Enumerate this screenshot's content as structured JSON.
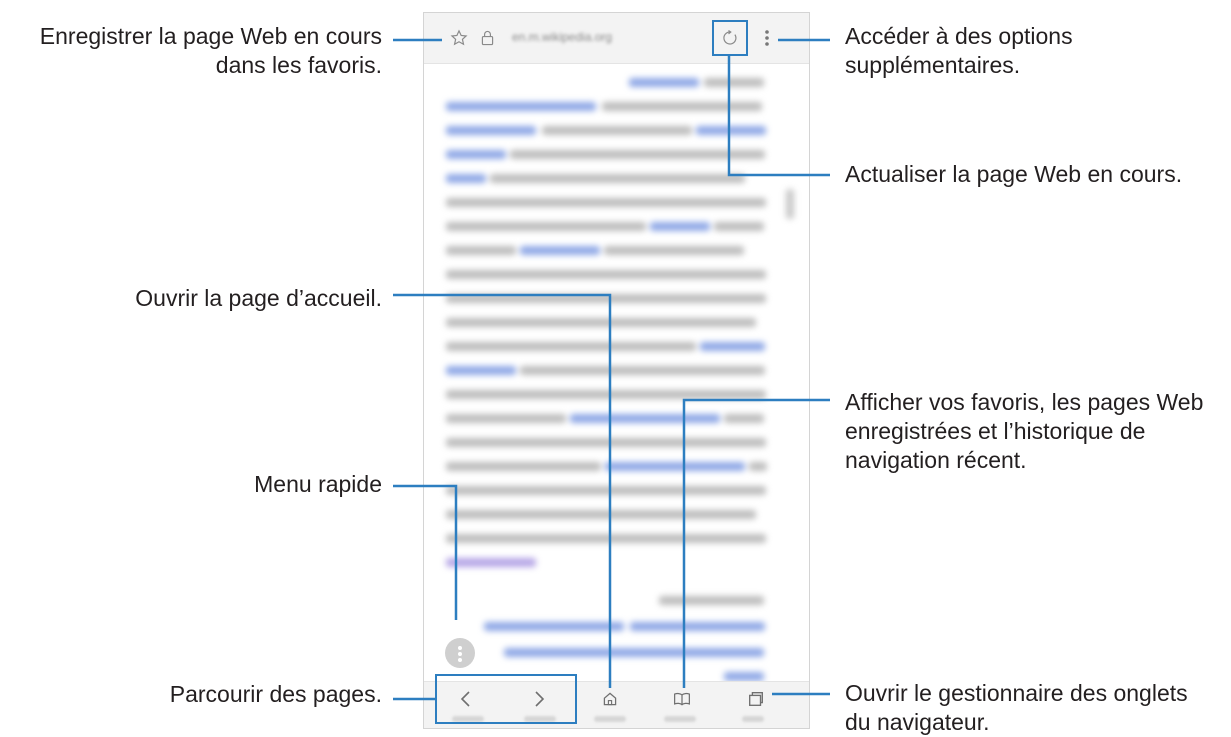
{
  "browser": {
    "url": "en.m.wikipedia.org"
  },
  "callouts": {
    "bookmark": [
      "Enregistrer la page Web en cours",
      "dans les favoris."
    ],
    "more_options": [
      "Accéder à des options",
      "supplémentaires."
    ],
    "refresh": [
      "Actualiser la page Web en cours."
    ],
    "home": [
      "Ouvrir la page d’accueil."
    ],
    "bookmarks_history": [
      "Afficher vos favoris, les pages Web",
      "enregistrées et l’historique de",
      "navigation récent."
    ],
    "quick_menu": [
      "Menu rapide"
    ],
    "navigate": [
      "Parcourir des pages."
    ],
    "tabs_manager": [
      "Ouvrir le gestionnaire des onglets",
      "du navigateur."
    ]
  },
  "colors": {
    "callout_line": "#2d7ec0",
    "highlight": "#2d7ec0",
    "link_text": "#5b7fd6",
    "body_text": "#9a9a9a"
  }
}
